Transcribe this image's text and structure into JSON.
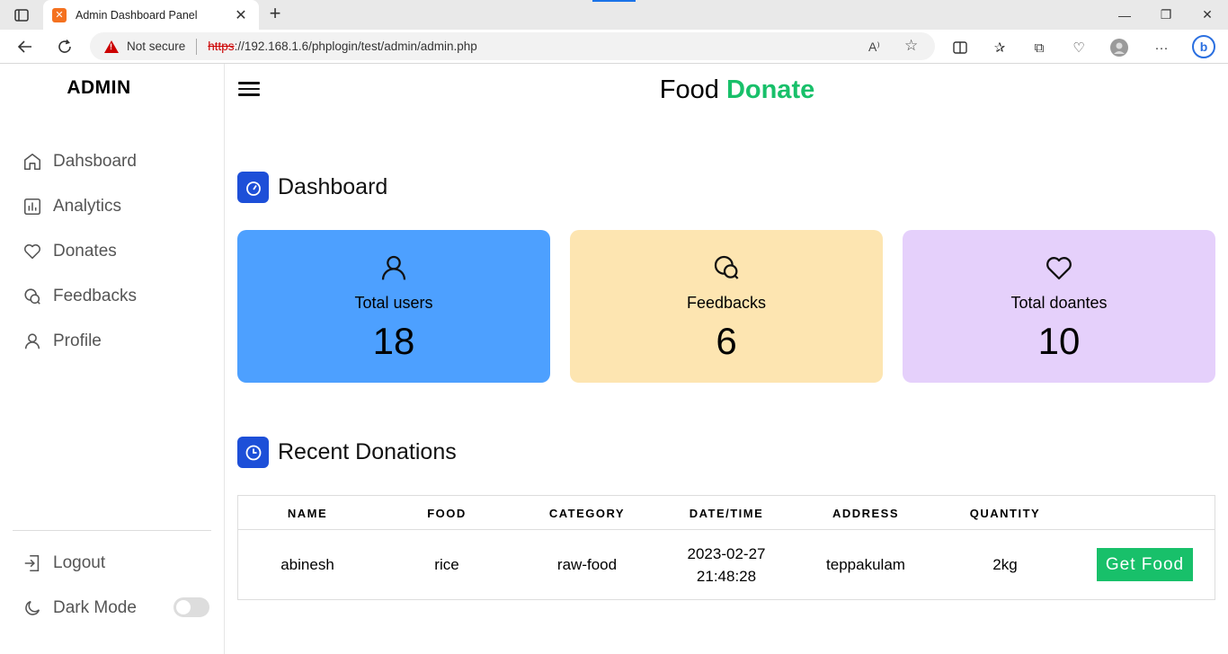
{
  "browser": {
    "tab_title": "Admin Dashboard Panel",
    "security_label": "Not secure",
    "url_scheme": "https",
    "url_rest": "://192.168.1.6/phplogin/test/admin/admin.php"
  },
  "sidebar": {
    "brand": "ADMIN",
    "items": [
      {
        "label": "Dahsboard",
        "icon": "home-icon"
      },
      {
        "label": "Analytics",
        "icon": "chart-icon"
      },
      {
        "label": "Donates",
        "icon": "heart-icon"
      },
      {
        "label": "Feedbacks",
        "icon": "chat-icon"
      },
      {
        "label": "Profile",
        "icon": "user-icon"
      }
    ],
    "logout_label": "Logout",
    "darkmode_label": "Dark Mode"
  },
  "header": {
    "title_part1": "Food",
    "title_part2": "Donate",
    "accent_color": "#18c06a"
  },
  "dashboard": {
    "title": "Dashboard",
    "cards": [
      {
        "label": "Total users",
        "value": "18",
        "color": "#4da0ff",
        "icon": "user-icon"
      },
      {
        "label": "Feedbacks",
        "value": "6",
        "color": "#fde5b1",
        "icon": "chat-icon"
      },
      {
        "label": "Total doantes",
        "value": "10",
        "color": "#e5d0fb",
        "icon": "heart-icon"
      }
    ]
  },
  "recent": {
    "title": "Recent Donations",
    "columns": [
      "NAME",
      "FOOD",
      "CATEGORY",
      "DATE/TIME",
      "ADDRESS",
      "QUANTITY"
    ],
    "rows": [
      {
        "name": "abinesh",
        "food": "rice",
        "category": "raw-food",
        "date": "2023-02-27",
        "time": "21:48:28",
        "address": "teppakulam",
        "quantity": "2kg",
        "action": "Get Food"
      }
    ]
  }
}
